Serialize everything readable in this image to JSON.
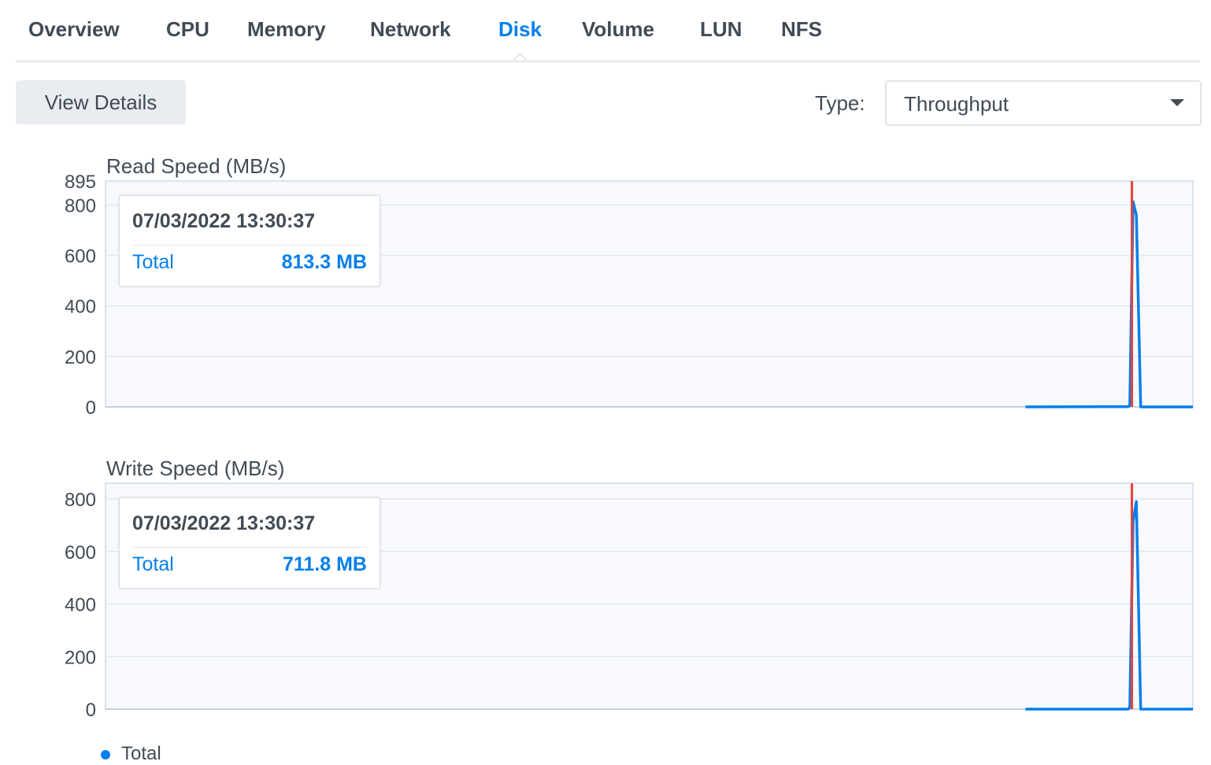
{
  "tabs": [
    {
      "label": "Overview"
    },
    {
      "label": "CPU"
    },
    {
      "label": "Memory"
    },
    {
      "label": "Network"
    },
    {
      "label": "Disk"
    },
    {
      "label": "Volume"
    },
    {
      "label": "LUN"
    },
    {
      "label": "NFS"
    }
  ],
  "active_tab": "Disk",
  "toolbar": {
    "view_details_label": "View Details",
    "type_label": "Type:",
    "type_value": "Throughput"
  },
  "colors": {
    "accent": "#057feb",
    "cursor_line": "#e8403a",
    "text": "#414b55"
  },
  "tooltips": {
    "read": {
      "time": "07/03/2022 13:30:37",
      "label": "Total",
      "value": "813.3 MB"
    },
    "write": {
      "time": "07/03/2022 13:30:37",
      "label": "Total",
      "value": "711.8 MB"
    }
  },
  "legend": {
    "label": "Total"
  },
  "chart_data": [
    {
      "type": "line",
      "title": "Read Speed (MB/s)",
      "ylim": [
        0,
        895
      ],
      "yticks": [
        "895",
        "800",
        "600",
        "400",
        "200",
        "0"
      ],
      "grid": true,
      "series": [
        {
          "name": "Total",
          "x_fraction": [
            0.0,
            0.845,
            0.846,
            0.94,
            0.941,
            0.942,
            0.945,
            0.948,
            0.952,
            1.0
          ],
          "values": [
            null,
            null,
            0,
            1,
            2,
            10,
            813.3,
            760,
            0,
            0
          ]
        }
      ],
      "cursor_x_fraction": 0.945
    },
    {
      "type": "line",
      "title": "Write Speed (MB/s)",
      "ylim": [
        0,
        860
      ],
      "yticks": [
        "800",
        "600",
        "400",
        "200",
        "0"
      ],
      "grid": true,
      "series": [
        {
          "name": "Total",
          "x_fraction": [
            0.0,
            0.845,
            0.846,
            0.94,
            0.941,
            0.942,
            0.945,
            0.948,
            0.952,
            1.0
          ],
          "values": [
            null,
            null,
            0,
            0,
            1,
            10,
            711.8,
            790,
            0,
            0
          ]
        }
      ],
      "cursor_x_fraction": 0.945
    }
  ]
}
